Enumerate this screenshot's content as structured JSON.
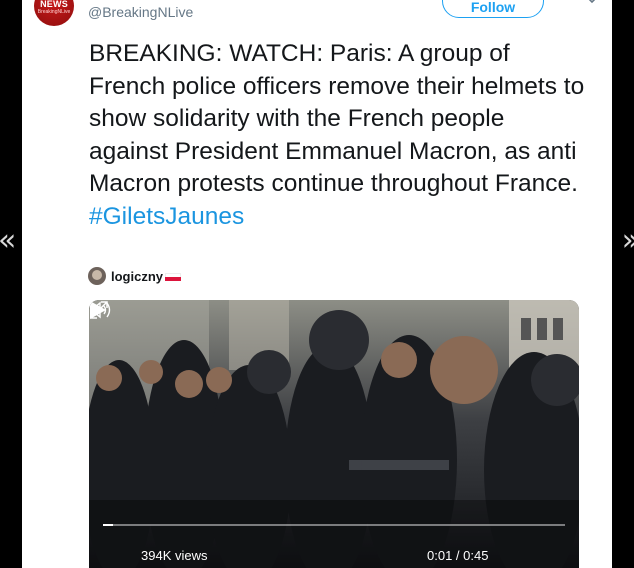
{
  "account": {
    "avatar_brand": "NEWS",
    "avatar_sub": "BreakingNLive",
    "handle": "@BreakingNLive",
    "follow_label": "Follow"
  },
  "tweet": {
    "text": "BREAKING: WATCH: Paris: A group of French police officers remove their helmets to show solidarity with the French people against President Emmanuel Macron, as anti Macron protests continue throughout France.",
    "hashtag": "#GiletsJaunes"
  },
  "quoted": {
    "author": "logiczny",
    "flag_icon": "poland-flag-icon"
  },
  "video": {
    "views": "394K views",
    "time": "0:01 / 0:45",
    "progress": 0.022
  },
  "nav": {
    "prev_glyph": "«",
    "next_glyph": "»"
  },
  "colors": {
    "accent": "#1da1f2",
    "hashtag": "#1b95e0",
    "text": "#14171a",
    "muted": "#657786",
    "brand_red": "#c81a1a"
  }
}
